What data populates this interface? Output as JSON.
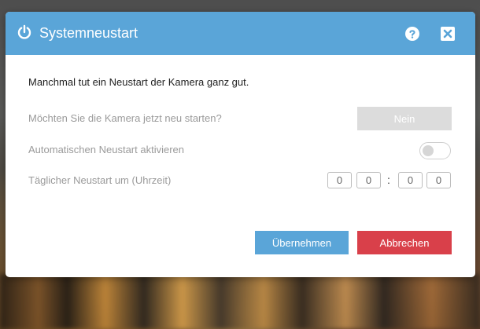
{
  "dialog": {
    "title": "Systemneustart",
    "title_icon": "power-icon",
    "help_icon": "help-icon",
    "close_icon": "close-icon",
    "header_color": "#5aa5d8"
  },
  "content": {
    "intro": "Manchmal tut ein Neustart der Kamera ganz gut.",
    "restart_question": "Möchten Sie die Kamera jetzt neu starten?",
    "restart_button_label": "Nein",
    "auto_restart_label": "Automatischen Neustart aktivieren",
    "auto_restart_enabled": false,
    "daily_restart_label": "Täglicher Neustart um (Uhrzeit)",
    "time": {
      "hour_tens": "0",
      "hour_ones": "0",
      "separator": ":",
      "minute_tens": "0",
      "minute_ones": "0"
    }
  },
  "footer": {
    "apply_label": "Übernehmen",
    "cancel_label": "Abbrechen",
    "apply_color": "#5aa5d8",
    "cancel_color": "#d9404a"
  }
}
